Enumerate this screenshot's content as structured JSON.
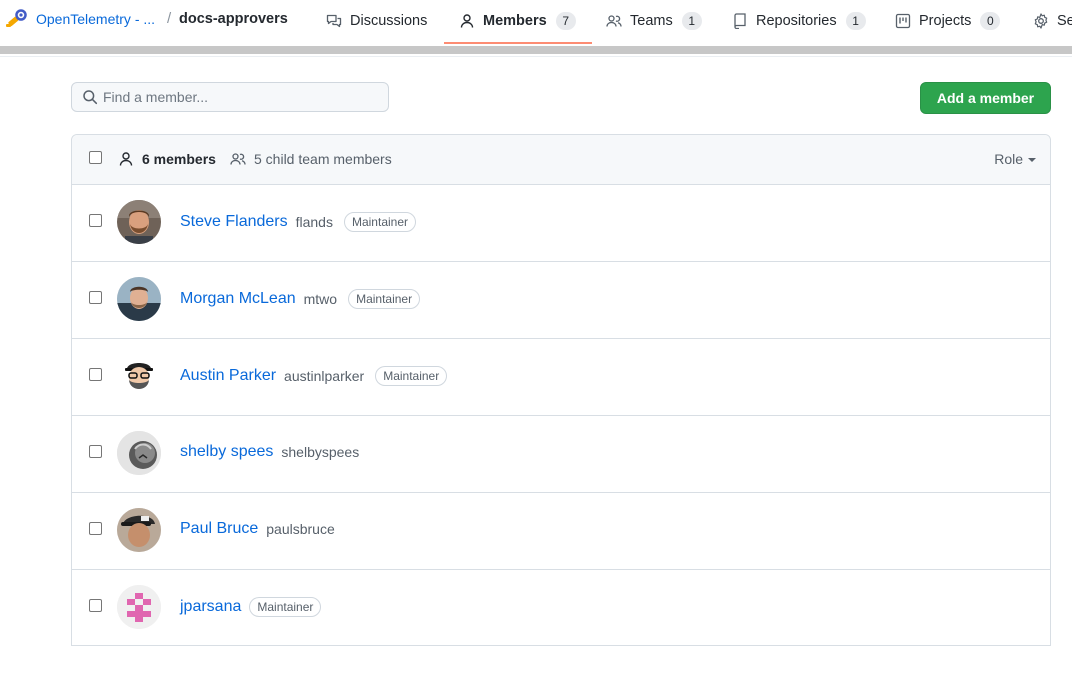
{
  "breadcrumb": {
    "org": "OpenTelemetry - ...",
    "separator": "/",
    "team": "docs-approvers"
  },
  "tabs": [
    {
      "label": "Discussions",
      "icon": "comment-discussion-icon"
    },
    {
      "label": "Members",
      "count": "7",
      "icon": "person-icon",
      "active": true
    },
    {
      "label": "Teams",
      "count": "1",
      "icon": "people-icon"
    },
    {
      "label": "Repositories",
      "count": "1",
      "icon": "repo-icon"
    },
    {
      "label": "Projects",
      "count": "0",
      "icon": "project-icon"
    },
    {
      "label": "Se",
      "icon": "gear-icon"
    }
  ],
  "search": {
    "placeholder": "Find a member..."
  },
  "add_member_label": "Add a member",
  "header": {
    "members_count": "6 members",
    "child_team_members": "5 child team members",
    "role_filter": "Role"
  },
  "members": [
    {
      "name": "Steve Flanders",
      "login": "flands",
      "role": "Maintainer"
    },
    {
      "name": "Morgan McLean",
      "login": "mtwo",
      "role": "Maintainer"
    },
    {
      "name": "Austin Parker",
      "login": "austinlparker",
      "role": "Maintainer"
    },
    {
      "name": "shelby spees",
      "login": "shelbyspees",
      "role": ""
    },
    {
      "name": "Paul Bruce",
      "login": "paulsbruce",
      "role": ""
    },
    {
      "name": "jparsana",
      "login": "",
      "role": "Maintainer"
    }
  ],
  "colors": {
    "link": "#0969da",
    "primary_button": "#2da44e",
    "active_tab_underline": "#fd8c73"
  }
}
